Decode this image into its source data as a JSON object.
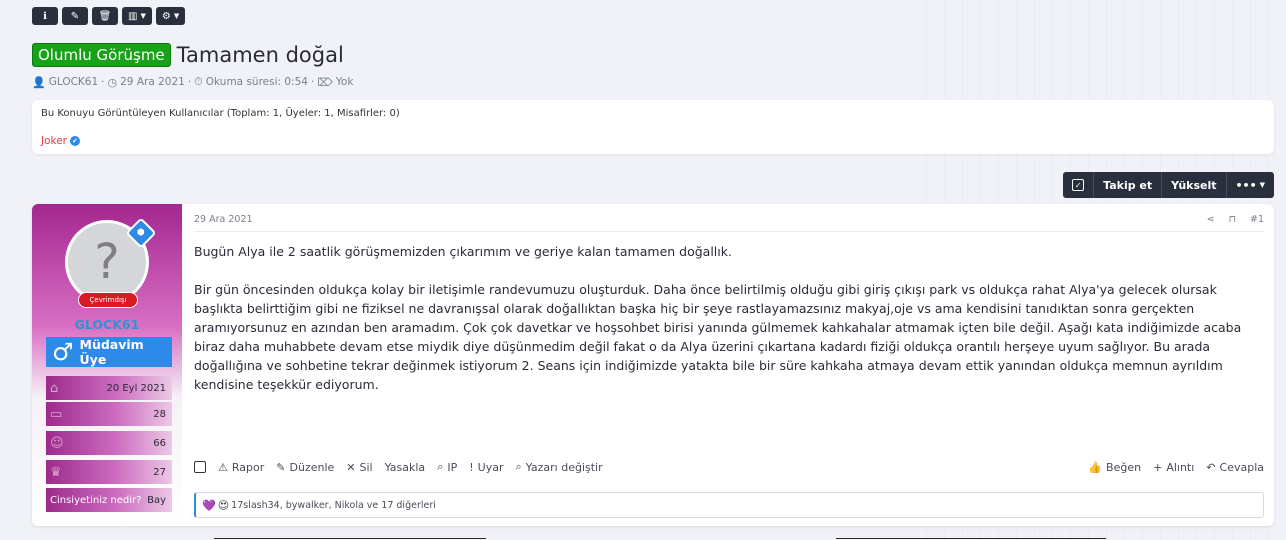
{
  "admin_toolbar": {
    "buttons": [
      {
        "name": "info-button",
        "icon": "info-icon",
        "glyph": "ℹ",
        "caret": false
      },
      {
        "name": "edit-button",
        "icon": "edit-icon",
        "glyph": "✎",
        "caret": false
      },
      {
        "name": "delete-button",
        "icon": "trash-icon",
        "glyph": "🗑",
        "caret": false
      },
      {
        "name": "stats-button",
        "icon": "chart-icon",
        "glyph": "▥",
        "caret": true
      },
      {
        "name": "settings-button",
        "icon": "gear-icon",
        "glyph": "⚙",
        "caret": true
      }
    ]
  },
  "thread": {
    "prefix": "Olumlu Görüşme",
    "title": "Tamamen doğal",
    "author": "GLOCK61",
    "date": "29 Ara 2021",
    "read_time": "Okuma süresi: 0:54",
    "tags": "Yok",
    "sep": "·"
  },
  "viewers": {
    "title": "Bu Konuyu Görüntüleyen Kullanıcılar (Toplam: 1, Üyeler: 1, Misafirler: 0)",
    "user": "Joker",
    "verified_glyph": "✔"
  },
  "thread_actions": {
    "follow": "Takip et",
    "bump": "Yükselt",
    "more": "•••"
  },
  "post": {
    "date": "29 Ara 2021",
    "number": "#1",
    "paragraphs": [
      "Bugün Alya ile 2 saatlik görüşmemizden çıkarımım ve geriye kalan tamamen doğallık.",
      "Bir gün öncesinden oldukça kolay bir iletişimle randevumuzu oluşturduk. Daha önce belirtilmiş olduğu gibi giriş çıkışı park vs oldukça rahat Alya'ya gelecek olursak başlıkta belirttiğim gibi ne fiziksel ne davranışsal olarak doğallıktan başka hiç bir şeye rastlayamazsınız makyaj,oje vs ama kendisini tanıdıktan sonra gerçekten aramıyorsunuz en azından ben aramadım. Çok çok davetkar ve hoşsohbet birisi yanında gülmemek kahkahalar atmamak içten bile değil. Aşağı kata indiğimizde acaba biraz daha muhabbete devam etse miydik diye düşünmedim değil fakat o da Alya üzerini çıkartana kadardı fiziği oldukça orantılı herşeye uyum sağlıyor. Bu arada doğallığına ve sohbetine tekrar değinmek istiyorum 2. Seans için indiğimizde yatakta bile bir süre kahkaha atmaya devam ettik yanından oldukça memnun ayrıldım kendisine teşekkür ediyorum."
    ],
    "actions_left": {
      "report": "Rapor",
      "edit": "Düzenle",
      "delete": "Sil",
      "ban": "Yasakla",
      "ip": "IP",
      "warn": "Uyar",
      "change_author": "Yazarı değiştir"
    },
    "actions_right": {
      "like": "Beğen",
      "quote": "Alıntı",
      "reply": "Cevapla"
    },
    "reactions_text": "17slash34, bywalker, Nikola ve 17 diğerleri"
  },
  "user": {
    "name": "GLOCK61",
    "status": "Çevrimdışı",
    "rank": "Müdavim Üye",
    "rank_symbol": "♂",
    "avatar_letter": "?",
    "stats": [
      {
        "icon": "home-icon",
        "glyph": "⌂",
        "value": "20 Eyl 2021"
      },
      {
        "icon": "message-icon",
        "glyph": "▭",
        "value": "28"
      },
      {
        "icon": "reaction-icon",
        "glyph": "☺",
        "value": "66"
      },
      {
        "icon": "points-icon",
        "glyph": "♛",
        "value": "27"
      }
    ],
    "gender_label": "Cinsiyetiniz nedir?",
    "gender_value": "Bay"
  }
}
